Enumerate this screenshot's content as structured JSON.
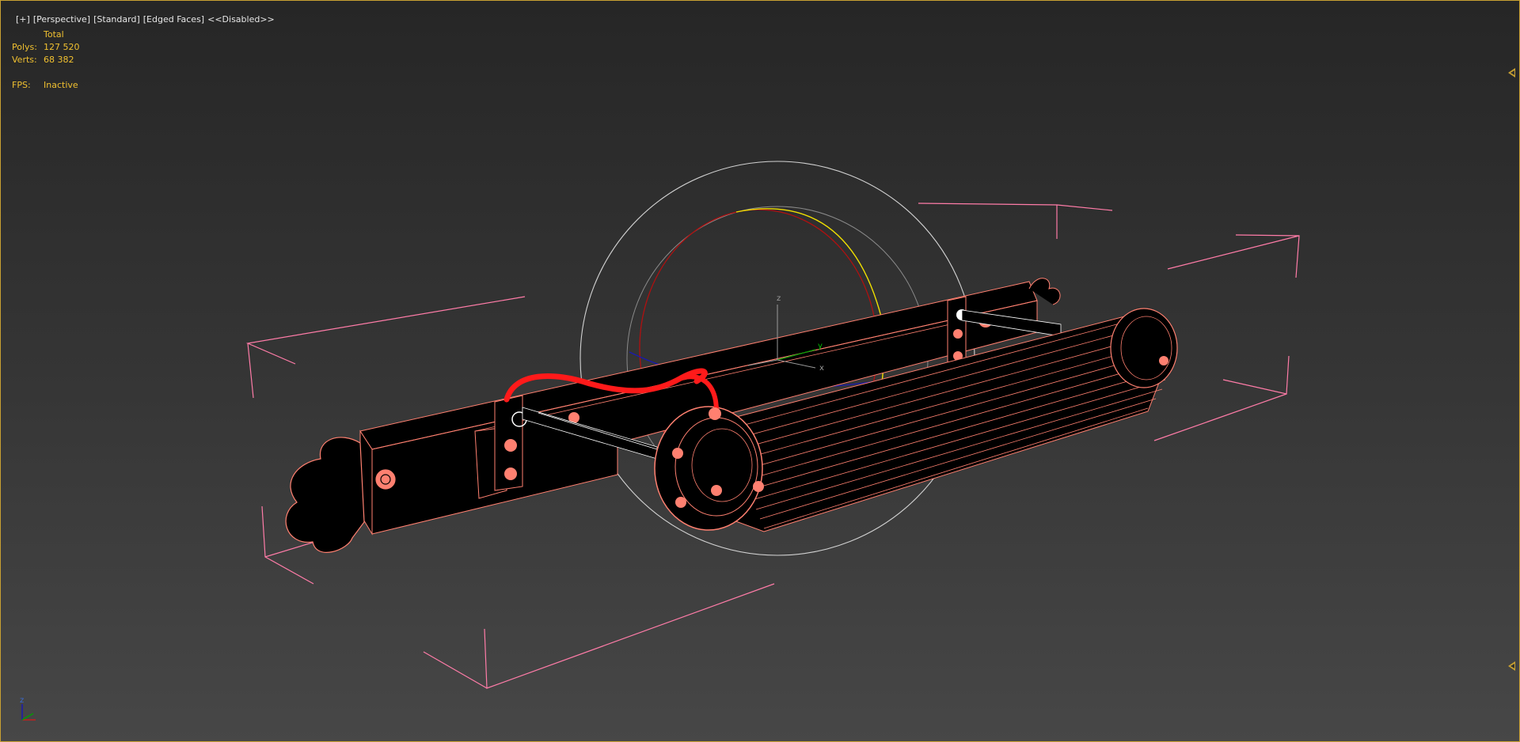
{
  "viewport": {
    "label_plus": "[+]",
    "label_view": "[Perspective]",
    "label_shading": "[Standard]",
    "label_mode": "[Edged Faces]",
    "label_status": "<<Disabled>>"
  },
  "stats": {
    "total_label": "Total",
    "polys_label": "Polys:",
    "polys_value": "127 520",
    "verts_label": "Verts:",
    "verts_value": "68 382",
    "fps_label": "FPS:",
    "fps_value": "Inactive"
  },
  "gizmo": {
    "axis_x": "x",
    "axis_y": "y",
    "axis_z": "z"
  },
  "axis_tripod": {
    "axis_z": "z"
  },
  "colors": {
    "wire": "#ff8070",
    "bbox": "#ff7ca8",
    "selected_cable": "#ff1a1a",
    "gizmo_ring": "#c8c8c8",
    "gizmo_yellow": "#f0e000",
    "gizmo_red": "#c01010",
    "gizmo_blue": "#1a1ab0",
    "accent": "#c8a032"
  },
  "icons": [
    "expand-viewport-marker-icon",
    "axis-tripod-icon",
    "rotate-gizmo-icon"
  ]
}
